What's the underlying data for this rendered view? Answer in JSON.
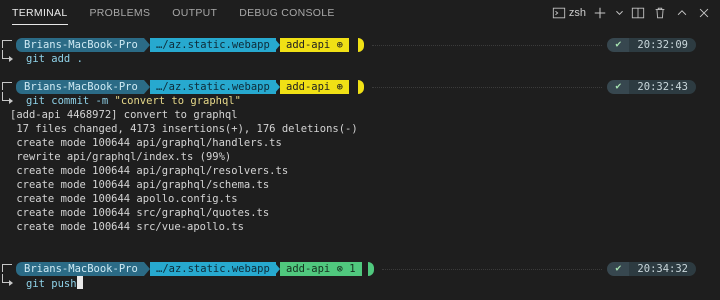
{
  "tabs": [
    {
      "label": "TERMINAL",
      "active": true
    },
    {
      "label": "PROBLEMS",
      "active": false
    },
    {
      "label": "OUTPUT",
      "active": false
    },
    {
      "label": "DEBUG CONSOLE",
      "active": false
    }
  ],
  "toolbar": {
    "shell_icon": "terminal-icon",
    "shell_name": "zsh",
    "new_icon": "plus-icon",
    "dropdown_icon": "chevron-down-icon",
    "split_icon": "split-icon",
    "trash_icon": "trash-icon",
    "maximize_icon": "chevron-up-icon",
    "close_icon": "close-icon"
  },
  "prompts": [
    {
      "host": "Brians-MacBook-Pro",
      "path": "…/az.static.webapp",
      "git": "add-api ⊕",
      "git_color": "#f0e015",
      "status": "✔",
      "time": "20:32:09",
      "command": "git add ."
    },
    {
      "host": "Brians-MacBook-Pro",
      "path": "…/az.static.webapp",
      "git": "add-api ⊕",
      "git_color": "#f0e015",
      "status": "✔",
      "time": "20:32:43",
      "command_pre": "git commit -m ",
      "command_str": "\"convert to graphql\""
    },
    {
      "host": "Brians-MacBook-Pro",
      "path": "…/az.static.webapp",
      "git": "add-api ⊗ 1",
      "git_color": "#50c87e",
      "status": "✔",
      "time": "20:34:32",
      "command": "git push"
    }
  ],
  "output_lines": [
    "[add-api 4468972] convert to graphql",
    " 17 files changed, 4173 insertions(+), 176 deletions(-)",
    " create mode 100644 api/graphql/handlers.ts",
    " rewrite api/graphql/index.ts (99%)",
    " create mode 100644 api/graphql/resolvers.ts",
    " create mode 100644 api/graphql/schema.ts",
    " create mode 100644 apollo.config.ts",
    " create mode 100644 src/graphql/quotes.ts",
    " create mode 100644 src/vue-apollo.ts"
  ]
}
